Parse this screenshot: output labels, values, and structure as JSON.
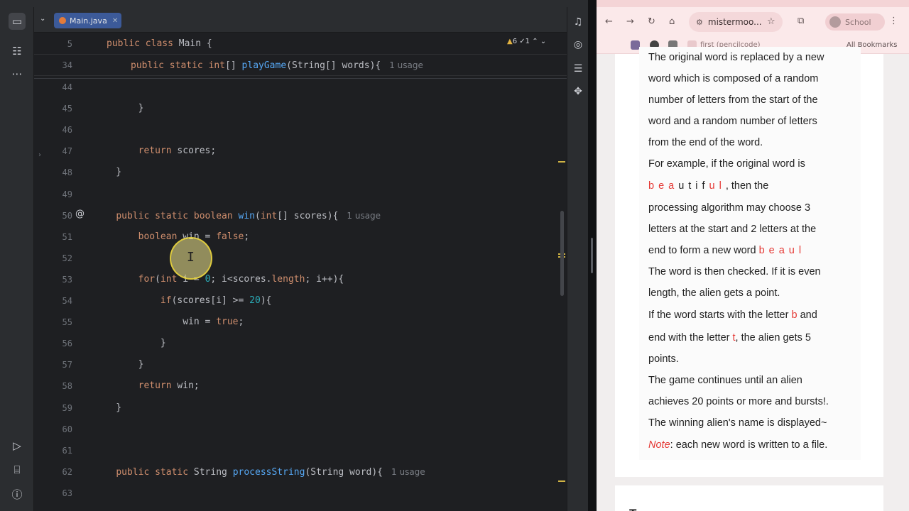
{
  "ide": {
    "tab": {
      "label": "Main.java"
    },
    "inspections": {
      "warnings": "6",
      "weak": "1"
    },
    "sticky": [
      {
        "no": "5",
        "parts": [
          [
            "kw",
            "public class "
          ],
          [
            "p",
            "Main {"
          ]
        ]
      },
      {
        "no": "34",
        "parts": [
          [
            "kw",
            "public static "
          ],
          [
            "kw",
            "int"
          ],
          [
            "p",
            "[] "
          ],
          [
            "fn",
            "playGame"
          ],
          [
            "p",
            "(String[] words){"
          ],
          [
            "hint",
            "1 usage"
          ]
        ]
      }
    ],
    "lines": [
      {
        "no": "44",
        "parts": []
      },
      {
        "no": "45",
        "parts": [
          [
            "p",
            "        }"
          ]
        ]
      },
      {
        "no": "46",
        "parts": []
      },
      {
        "no": "47",
        "parts": [
          [
            "p",
            "        "
          ],
          [
            "kw",
            "return "
          ],
          [
            "p",
            "scores;"
          ]
        ]
      },
      {
        "no": "48",
        "parts": [
          [
            "p",
            "    }"
          ]
        ]
      },
      {
        "no": "49",
        "parts": []
      },
      {
        "no": "50",
        "parts": [
          [
            "p",
            "    "
          ],
          [
            "kw",
            "public static boolean "
          ],
          [
            "fn",
            "win"
          ],
          [
            "p",
            "("
          ],
          [
            "kw",
            "int"
          ],
          [
            "p",
            "[] scores){"
          ],
          [
            "hint",
            "1 usage"
          ]
        ]
      },
      {
        "no": "51",
        "parts": [
          [
            "p",
            "        "
          ],
          [
            "kw",
            "boolean "
          ],
          [
            "p",
            "win = "
          ],
          [
            "kw",
            "false"
          ],
          [
            "p",
            ";"
          ]
        ]
      },
      {
        "no": "52",
        "parts": []
      },
      {
        "no": "53",
        "parts": [
          [
            "p",
            "        "
          ],
          [
            "kw",
            "for"
          ],
          [
            "p",
            "("
          ],
          [
            "kw",
            "int "
          ],
          [
            "p",
            "i = "
          ],
          [
            "num",
            "0"
          ],
          [
            "p",
            "; i<scores."
          ],
          [
            "kw",
            "length"
          ],
          [
            "p",
            "; i++){"
          ]
        ]
      },
      {
        "no": "54",
        "parts": [
          [
            "p",
            "            "
          ],
          [
            "kw",
            "if"
          ],
          [
            "p",
            "(scores[i] >= "
          ],
          [
            "num",
            "20"
          ],
          [
            "p",
            "){"
          ]
        ]
      },
      {
        "no": "55",
        "parts": [
          [
            "p",
            "                win = "
          ],
          [
            "kw",
            "true"
          ],
          [
            "p",
            ";"
          ]
        ]
      },
      {
        "no": "56",
        "parts": [
          [
            "p",
            "            }"
          ]
        ]
      },
      {
        "no": "57",
        "parts": [
          [
            "p",
            "        }"
          ]
        ]
      },
      {
        "no": "58",
        "parts": [
          [
            "p",
            "        "
          ],
          [
            "kw",
            "return "
          ],
          [
            "p",
            "win;"
          ]
        ]
      },
      {
        "no": "59",
        "parts": [
          [
            "p",
            "    }"
          ]
        ]
      },
      {
        "no": "60",
        "parts": []
      },
      {
        "no": "61",
        "parts": []
      },
      {
        "no": "62",
        "parts": [
          [
            "p",
            "    "
          ],
          [
            "kw",
            "public static "
          ],
          [
            "p",
            "String "
          ],
          [
            "fn",
            "processString"
          ],
          [
            "p",
            "(String word){"
          ],
          [
            "hint",
            "1 usage"
          ]
        ]
      },
      {
        "no": "63",
        "parts": []
      }
    ]
  },
  "browser": {
    "address": "mistermoo...",
    "profile": "School",
    "bookmarks": {
      "first": "first (pencilcode)",
      "all": "All Bookmarks"
    },
    "doc": [
      [
        [
          "t",
          "The original word is replaced by a new"
        ]
      ],
      [
        [
          "t",
          "word which is composed of a random"
        ]
      ],
      [
        [
          "t",
          "number of letters from the start of the"
        ]
      ],
      [
        [
          "t",
          "word and a random number of letters"
        ]
      ],
      [
        [
          "t",
          "from the end of the word."
        ]
      ],
      [
        [
          "t",
          "For example, if the original word is"
        ]
      ],
      [
        [
          "rs",
          "bea"
        ],
        [
          "s",
          "utif"
        ],
        [
          "rs",
          "ul"
        ],
        [
          "t",
          ", then the"
        ]
      ],
      [
        [
          "t",
          "processing algorithm may choose 3"
        ]
      ],
      [
        [
          "t",
          "letters at the start and 2 letters at the"
        ]
      ],
      [
        [
          "t",
          "end to form a new word "
        ],
        [
          "rs",
          "beaul"
        ]
      ],
      [
        [
          "t",
          "The word is then checked. If it is even"
        ]
      ],
      [
        [
          "t",
          "length, the alien gets a point."
        ]
      ],
      [
        [
          "t",
          "If the word starts with the letter "
        ],
        [
          "r",
          "b"
        ],
        [
          "t",
          " and"
        ]
      ],
      [
        [
          "t",
          "end with the letter "
        ],
        [
          "r",
          "t"
        ],
        [
          "t",
          ", the alien gets 5"
        ]
      ],
      [
        [
          "t",
          "points."
        ]
      ],
      [
        [
          "t",
          "The game continues until an alien"
        ]
      ],
      [
        [
          "t",
          "achieves 20 points or more and bursts!."
        ]
      ],
      [
        [
          "t",
          "The winning alien's name is displayed~"
        ]
      ],
      [
        [
          "ri",
          "Note"
        ],
        [
          "t",
          ": each new word is written to a file."
        ]
      ]
    ],
    "next_card_title": "To"
  }
}
